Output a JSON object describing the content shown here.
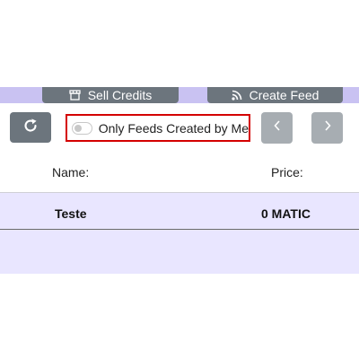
{
  "header": {
    "sell_credits_label": "Sell Credits",
    "create_feed_label": "Create Feed",
    "sell_credits_icon": "store-icon",
    "create_feed_icon": "rss-icon"
  },
  "toolbar": {
    "refresh_icon": "refresh-icon",
    "filter_label": "Only Feeds Created by Me",
    "filter_checked": false,
    "prev_icon": "chevron-left-icon",
    "next_icon": "chevron-right-icon"
  },
  "table": {
    "headers": {
      "name": "Name:",
      "price": "Price:"
    },
    "rows": [
      {
        "name": "Teste",
        "price": "0 MATIC"
      },
      {
        "name": "",
        "price": ""
      }
    ]
  },
  "colors": {
    "band": "#c9c2f2",
    "button": "#6c757d",
    "row": "#e9e6ff",
    "highlight": "#d40000"
  }
}
